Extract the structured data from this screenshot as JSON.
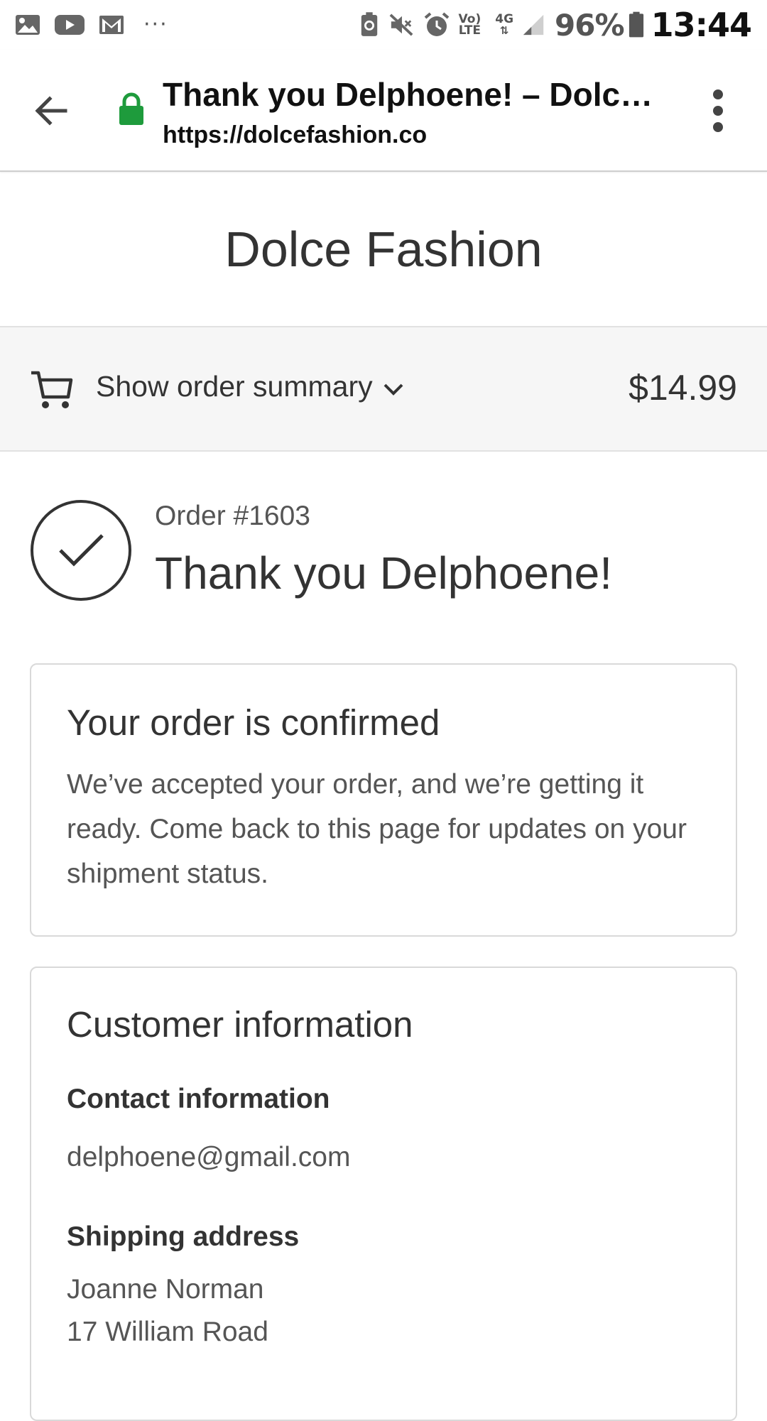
{
  "status_bar": {
    "icons_left": [
      "image-icon",
      "youtube-icon",
      "gmail-icon"
    ],
    "overflow": "···",
    "icons_right": [
      "recycle-icon",
      "mute-icon",
      "alarm-icon"
    ],
    "volte_top": "Vo)",
    "volte_bottom": "LTE",
    "network": "4G",
    "battery_percent": "96%",
    "time": "13:44"
  },
  "browser": {
    "tab_title": "Thank you Delphoene! – Dolce Fashion",
    "url": "https://dolcefashion.co",
    "lock_color": "#1e9b3c"
  },
  "store": {
    "name": "Dolce Fashion"
  },
  "order_summary": {
    "label": "Show order summary",
    "total": "$14.99"
  },
  "confirmation": {
    "order_number": "Order #1603",
    "thank_you": "Thank you Delphoene!"
  },
  "confirmed_card": {
    "title": "Your order is confirmed",
    "body": "We’ve accepted your order, and we’re getting it ready. Come back to this page for updates on your shipment status."
  },
  "customer_card": {
    "title": "Customer information",
    "contact_label": "Contact information",
    "contact_email": "delphoene@gmail.com",
    "shipping_label": "Shipping address",
    "shipping_lines": [
      "Joanne Norman",
      "17 William Road"
    ]
  }
}
